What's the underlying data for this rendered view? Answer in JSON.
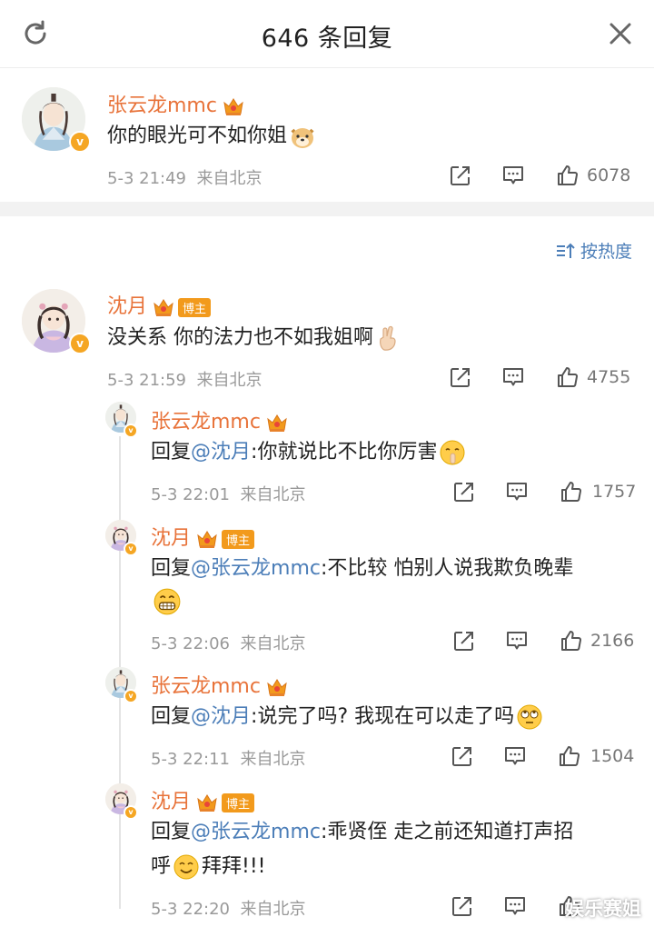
{
  "header": {
    "title": "646 条回复"
  },
  "main_comment": {
    "user": "张云龙mmc",
    "text": "你的眼光可不如你姐",
    "time": "5-3 21:49",
    "location": "来自北京",
    "likes": "6078"
  },
  "sort": {
    "label": "按热度"
  },
  "top_comment": {
    "user": "沈月",
    "badge": "博主",
    "text": "没关系 你的法力也不如我姐啊",
    "time": "5-3 21:59",
    "location": "来自北京",
    "likes": "4755"
  },
  "replies": [
    {
      "user": "张云龙mmc",
      "prefix": "回复",
      "mention": "@沈月",
      "text": ":你就说比不比你厉害",
      "time": "5-3 22:01",
      "location": "来自北京",
      "likes": "1757"
    },
    {
      "user": "沈月",
      "badge": "博主",
      "prefix": "回复",
      "mention": "@张云龙mmc",
      "text": ":不比较 怕别人说我欺负晚辈",
      "time": "5-3 22:06",
      "location": "来自北京",
      "likes": "2166"
    },
    {
      "user": "张云龙mmc",
      "prefix": "回复",
      "mention": "@沈月",
      "text": ":说完了吗? 我现在可以走了吗",
      "time": "5-3 22:11",
      "location": "来自北京",
      "likes": "1504"
    },
    {
      "user": "沈月",
      "badge": "博主",
      "prefix": "回复",
      "mention": "@张云龙mmc",
      "text": ":乖贤侄 走之前还知道打声招",
      "text2": "呼",
      "text3": "拜拜!!!",
      "time": "5-3 22:20",
      "location": "来自北京"
    }
  ],
  "watermark": "娱乐赛姐",
  "colors": {
    "username": "#e8733a",
    "mention": "#4c7eb8",
    "meta": "#999999",
    "badge": "#f5a623"
  }
}
